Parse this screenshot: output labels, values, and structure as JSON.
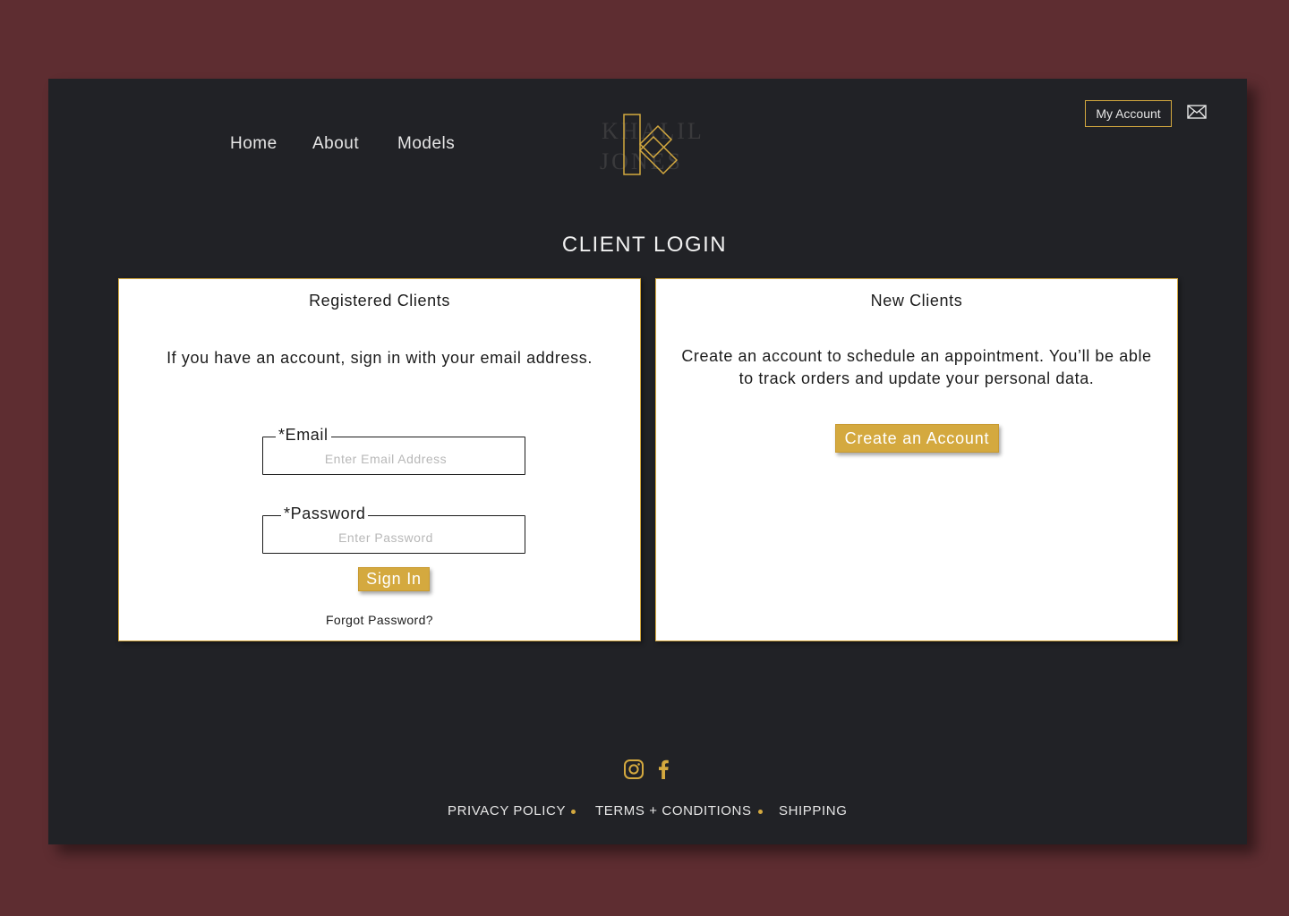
{
  "nav": {
    "items": [
      {
        "label": "Home"
      },
      {
        "label": "About"
      },
      {
        "label": "Models"
      }
    ]
  },
  "logo": {
    "line1": "KHALIL",
    "line2": "JONES",
    "icon": "k-monogram-logo"
  },
  "header": {
    "my_account_label": "My Account",
    "mail_icon": "mail-icon"
  },
  "page": {
    "title": "CLIENT LOGIN"
  },
  "registered": {
    "title": "Registered Clients",
    "description": "If you have an account, sign in with your email address.",
    "email_label": "*Email",
    "email_placeholder": "Enter Email Address",
    "password_label": "*Password",
    "password_placeholder": "Enter Password",
    "signin_label": "Sign In",
    "forgot_label": "Forgot Password?"
  },
  "new_clients": {
    "title": "New Clients",
    "description": "Create an account to schedule an appointment. You’ll be able to track orders and update your personal data.",
    "create_label": "Create an Account"
  },
  "footer": {
    "social_icons": [
      "instagram-icon",
      "facebook-icon"
    ],
    "links": [
      {
        "label": "PRIVACY POLICY"
      },
      {
        "label": "TERMS + CONDITIONS"
      },
      {
        "label": "SHIPPING"
      }
    ]
  },
  "colors": {
    "accent": "#d4a93f",
    "background": "#5e2d31",
    "frame": "#212226"
  }
}
